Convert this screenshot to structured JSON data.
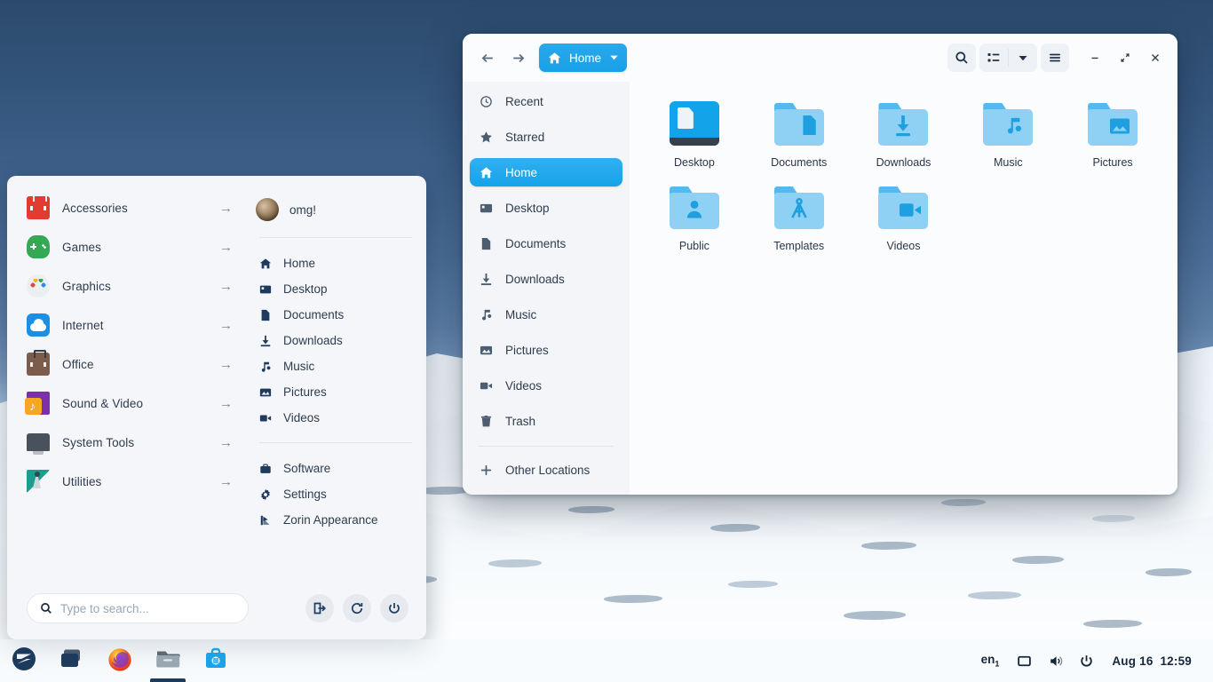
{
  "desktop": {
    "wallpaper_sky_top": "#2b4a6b",
    "wallpaper_sky_bottom": "#7a9ac0",
    "wallpaper_snow": "#f3f8fc"
  },
  "app_menu": {
    "categories": [
      {
        "label": "Accessories",
        "icon": "toolbox-icon",
        "arrow": "→"
      },
      {
        "label": "Games",
        "icon": "gamepad-icon",
        "arrow": "→"
      },
      {
        "label": "Graphics",
        "icon": "palette-icon",
        "arrow": "→"
      },
      {
        "label": "Internet",
        "icon": "cloud-icon",
        "arrow": "→"
      },
      {
        "label": "Office",
        "icon": "briefcase-icon",
        "arrow": "→"
      },
      {
        "label": "Sound & Video",
        "icon": "music-video-icon",
        "arrow": "→"
      },
      {
        "label": "System Tools",
        "icon": "monitor-icon",
        "arrow": "→"
      },
      {
        "label": "Utilities",
        "icon": "microscope-icon",
        "arrow": "→"
      }
    ],
    "user": {
      "name": "omg!"
    },
    "places": [
      {
        "label": "Home",
        "icon": "home-icon"
      },
      {
        "label": "Desktop",
        "icon": "desktop-icon"
      },
      {
        "label": "Documents",
        "icon": "document-icon"
      },
      {
        "label": "Downloads",
        "icon": "download-icon"
      },
      {
        "label": "Music",
        "icon": "music-note-icon"
      },
      {
        "label": "Pictures",
        "icon": "picture-icon"
      },
      {
        "label": "Videos",
        "icon": "video-camera-icon"
      }
    ],
    "tools": [
      {
        "label": "Software",
        "icon": "software-bag-icon"
      },
      {
        "label": "Settings",
        "icon": "gear-icon"
      },
      {
        "label": "Zorin Appearance",
        "icon": "zorin-appearance-icon"
      }
    ],
    "search": {
      "placeholder": "Type to search...",
      "value": "",
      "icon": "search-icon"
    },
    "session_buttons": [
      {
        "name": "log-out-button",
        "icon": "logout-icon"
      },
      {
        "name": "restart-button",
        "icon": "restart-icon"
      },
      {
        "name": "power-button",
        "icon": "power-icon"
      }
    ]
  },
  "files_window": {
    "nav": {
      "back": "back-icon",
      "forward": "forward-icon"
    },
    "pathbar": {
      "label": "Home",
      "icon": "home-icon",
      "caret": "▼",
      "accent": "#18a0e8"
    },
    "header_buttons": [
      {
        "name": "search-button",
        "icon": "search-icon"
      },
      {
        "name": "view-list-button",
        "icon": "list-view-icon"
      },
      {
        "name": "view-options-button",
        "icon": "chevron-down-icon"
      },
      {
        "name": "main-menu-button",
        "icon": "hamburger-icon"
      }
    ],
    "window_controls": {
      "minimize": "−",
      "maximize": "⤢",
      "close": "✕"
    },
    "sidebar": [
      {
        "label": "Recent",
        "icon": "clock-icon",
        "active": false
      },
      {
        "label": "Starred",
        "icon": "star-icon",
        "active": false
      },
      {
        "label": "Home",
        "icon": "home-icon",
        "active": true
      },
      {
        "label": "Desktop",
        "icon": "desktop-icon",
        "active": false
      },
      {
        "label": "Documents",
        "icon": "document-icon",
        "active": false
      },
      {
        "label": "Downloads",
        "icon": "download-icon",
        "active": false
      },
      {
        "label": "Music",
        "icon": "music-note-icon",
        "active": false
      },
      {
        "label": "Pictures",
        "icon": "picture-icon",
        "active": false
      },
      {
        "label": "Videos",
        "icon": "video-camera-icon",
        "active": false
      },
      {
        "label": "Trash",
        "icon": "trash-icon",
        "active": false
      }
    ],
    "sidebar_other": {
      "label": "Other Locations",
      "icon": "plus-icon"
    },
    "files": [
      {
        "name": "Desktop",
        "icon": "desktop-monitor-folder-icon"
      },
      {
        "name": "Documents",
        "icon": "documents-folder-icon"
      },
      {
        "name": "Downloads",
        "icon": "downloads-folder-icon"
      },
      {
        "name": "Music",
        "icon": "music-folder-icon"
      },
      {
        "name": "Pictures",
        "icon": "pictures-folder-icon"
      },
      {
        "name": "Public",
        "icon": "public-folder-icon"
      },
      {
        "name": "Templates",
        "icon": "templates-folder-icon"
      },
      {
        "name": "Videos",
        "icon": "videos-folder-icon"
      }
    ]
  },
  "taskbar": {
    "launchers": [
      {
        "name": "zorin-menu-button",
        "icon": "zorin-logo-icon",
        "active": false
      },
      {
        "name": "workspace-switcher-button",
        "icon": "workspaces-icon",
        "active": false
      },
      {
        "name": "firefox-button",
        "icon": "firefox-icon",
        "active": false
      },
      {
        "name": "files-button",
        "icon": "files-folder-icon",
        "active": true
      },
      {
        "name": "software-button",
        "icon": "software-bag-icon",
        "active": false
      }
    ],
    "tray": {
      "keyboard_layout": "en",
      "keyboard_index": "1",
      "icons": [
        {
          "name": "display-icon"
        },
        {
          "name": "volume-icon"
        },
        {
          "name": "power-icon"
        }
      ],
      "date": "Aug 16",
      "time": "12:59"
    }
  }
}
